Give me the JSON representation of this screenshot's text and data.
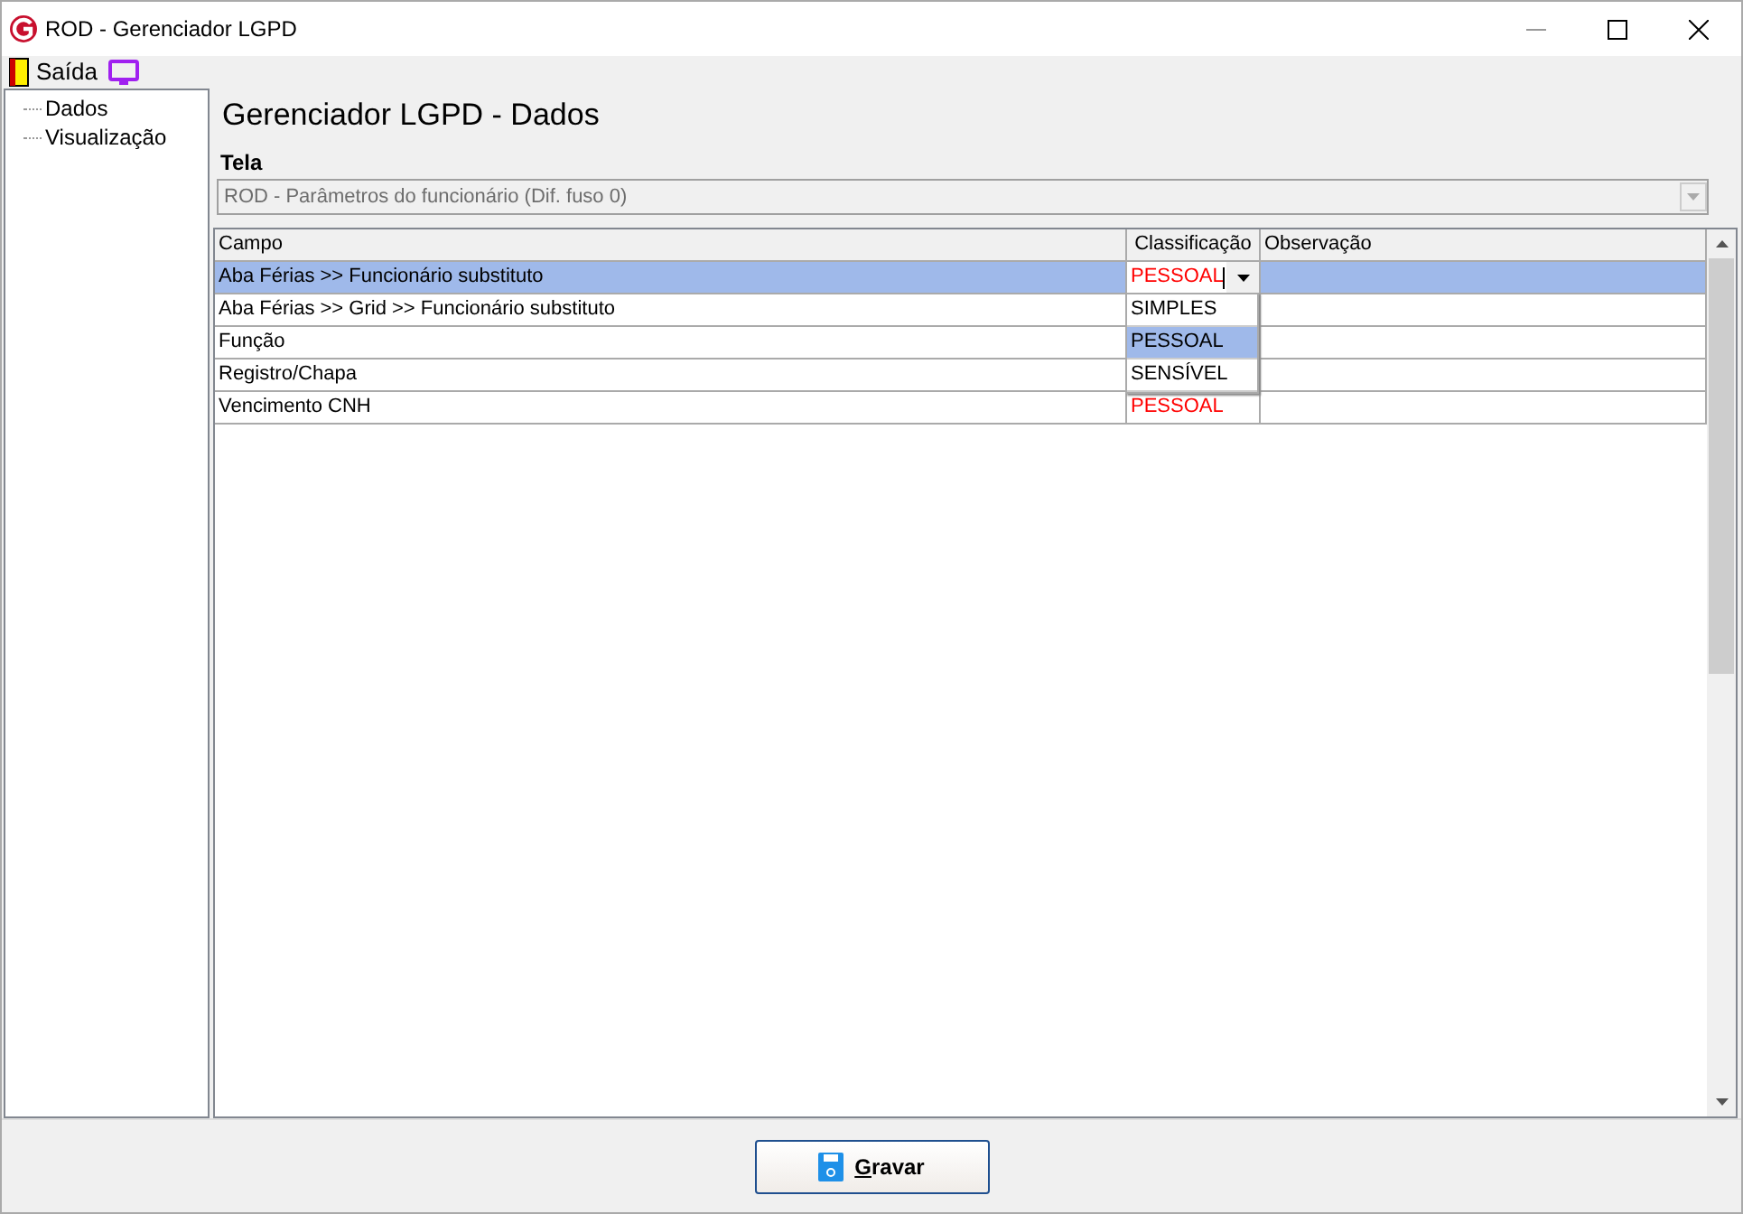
{
  "window": {
    "title": "ROD - Gerenciador LGPD"
  },
  "menu": [
    {
      "label": "Saída",
      "kind": "exit"
    },
    {
      "kind": "screen"
    }
  ],
  "tree": [
    {
      "label": "Dados"
    },
    {
      "label": "Visualização"
    }
  ],
  "heading": "Gerenciador LGPD - Dados",
  "tela": {
    "label": "Tela",
    "value": "ROD - Parâmetros do funcionário (Dif. fuso 0)",
    "disabled": true
  },
  "table": {
    "columns": [
      "Campo",
      "Classificação",
      "Observação"
    ],
    "rows": [
      {
        "campo": "Aba Férias >> Funcionário substituto",
        "classificacao": "PESSOAL",
        "selected": true,
        "editing": true
      },
      {
        "campo": "Aba Férias >> Grid >> Funcionário substituto",
        "selected": false,
        "editing": false
      },
      {
        "campo": "Função",
        "selected": false,
        "editing": false
      },
      {
        "campo": "Registro/Chapa",
        "selected": false,
        "editing": false
      },
      {
        "campo": "Vencimento CNH",
        "classificacao": "PESSOAL",
        "selected": false,
        "editing": false
      }
    ]
  },
  "dropdown_options": [
    {
      "label": "SIMPLES",
      "selected": false
    },
    {
      "label": "PESSOAL",
      "selected": true
    },
    {
      "label": "SENSÍVEL",
      "selected": false
    }
  ],
  "save_button": "Gravar"
}
